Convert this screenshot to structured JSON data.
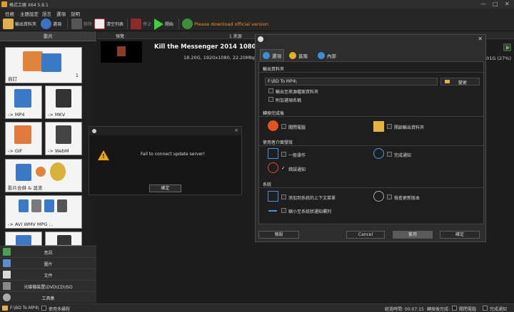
{
  "app": {
    "title": "格式工廠 X64 5.8.1",
    "window_controls": [
      "—",
      "□",
      "✕"
    ]
  },
  "menu": [
    "任務",
    "主題設定",
    "語言",
    "選項",
    "說明"
  ],
  "toolbar": {
    "output_folder": "輸出資料夾",
    "options": "選項",
    "remove": "移除",
    "clear_list": "清空列表",
    "stop": "停止",
    "start": "開始",
    "download_notice": "Please download official version"
  },
  "left_panel": {
    "header": "影片",
    "tiles": [
      {
        "label": "自訂",
        "count": "1"
      },
      {
        "label": "-> MP4",
        "badge": "MP4"
      },
      {
        "label": "-> MKV",
        "badge": "MKV"
      },
      {
        "label": "-> GIF",
        "badge": "GIF"
      },
      {
        "label": "-> WebM",
        "badge": "WebM"
      },
      {
        "label": "影片合併 & 混流"
      },
      {
        "label": "-> AVI WMV MPG ...",
        "badges": [
          "AVI",
          "FLV",
          "WMV",
          "3GP"
        ]
      }
    ],
    "categories": [
      "音訊",
      "圖片",
      "文件",
      "光碟機裝置\\DVD\\CD\\ISO",
      "工具集"
    ]
  },
  "list": {
    "headers": {
      "preview": "預覽",
      "source": "1 來源"
    },
    "row": {
      "filename": "Kill the Messenger 2014 1080p TW Blu-r",
      "info": "18.20G, 1920x1080, 22.20Mbp",
      "size_pct": "5.01G (27%)"
    }
  },
  "error_dialog": {
    "close": "×",
    "message": "Fail to connect update server!",
    "ok": "確定"
  },
  "settings_dialog": {
    "close": "✕",
    "tabs": [
      "選項",
      "進階",
      "內部"
    ],
    "output_folder": {
      "heading": "輸出資料夾",
      "path": "F:\\BD To MP4\\",
      "browse": "變更",
      "opt_source_folder": "輸出至來源檔案資料夾",
      "opt_append_name": "附加選項名稱"
    },
    "after_convert": {
      "heading": "轉換完成後",
      "shutdown": "關閉電腦",
      "open_output": "開啟輸出資料夾"
    },
    "ui_hints": {
      "heading": "使用者介面發效",
      "general": "一般操作",
      "complete_notify": "完成通知",
      "error_notify": "錯誤通知",
      "error_checked": "✓"
    },
    "system": {
      "heading": "系統",
      "add_context_menu": "添加到系統的上下文菜單",
      "check_updates": "檢查更新版本",
      "minimize_tray": "縮小至系統狀通知欄列"
    },
    "buttons": {
      "preset": "預設",
      "cancel": "Cancel",
      "apply": "套用",
      "ok": "確定"
    }
  },
  "status_bar": {
    "output_path": "F:\\BD To MP4\\",
    "multithread": "使用多續程",
    "elapsed": "經過時間: 00:07:15",
    "after_convert": "轉換後完成:",
    "shutdown": "關閉電腦",
    "notify": "完成通知"
  },
  "colors": {
    "accent_orange": "#f0a400",
    "start_green": "#3dd13d",
    "stop_red": "#c0392b",
    "download_orange": "#ff8a1e"
  }
}
